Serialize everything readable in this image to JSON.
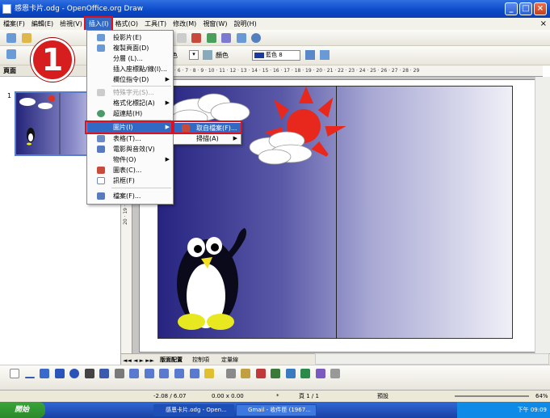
{
  "window": {
    "title": "感恩卡片.odg - OpenOffice.org Draw",
    "min": "_",
    "max": "□",
    "close": "×"
  },
  "menubar": [
    "檔案(F)",
    "編輯(E)",
    "檢視(V)",
    "插入(I)",
    "格式(O)",
    "工具(T)",
    "修改(M)",
    "視窗(W)",
    "說明(H)"
  ],
  "sidebar": {
    "header": "頁面",
    "thumb_number": "1"
  },
  "ruler": {
    "horizontal": "1 · 2 · 3 · 4 · 5 · 6 · 7 · 8 · 9 · 10 · 11 · 12 · 13 · 14 · 15 · 16 · 17 · 18 · 19 · 20 · 21 · 22 · 23 · 24 · 25 · 26 · 27 · 28 · 29",
    "vertical": "20 · 19 · 18 · 17 · 16 · 15 · 14 · 13 · 12 · 11 · 10 · 9"
  },
  "toolbar2": {
    "color_label": "色",
    "fill_label": "顏色",
    "fill_color_label": "藍色 8"
  },
  "insert_menu": {
    "items": [
      {
        "label": "投影片(E)",
        "disabled": false,
        "submenu": false
      },
      {
        "label": "複製頁面(D)",
        "disabled": false,
        "submenu": false
      },
      {
        "label": "分層 (L)...",
        "disabled": false,
        "submenu": false
      },
      {
        "label": "插入座標點/線(I)...",
        "disabled": false,
        "submenu": false
      },
      {
        "label": "欄位指令(D)",
        "disabled": false,
        "submenu": true
      },
      {
        "label": "特殊字元(S)...",
        "disabled": true,
        "submenu": false
      },
      {
        "label": "格式化標記(A)",
        "disabled": false,
        "submenu": true
      },
      {
        "label": "超連結(H)",
        "disabled": false,
        "submenu": false
      },
      {
        "label": "圖片(I)",
        "disabled": false,
        "submenu": true,
        "selected": true
      },
      {
        "label": "表格(T)...",
        "disabled": false,
        "submenu": false
      },
      {
        "label": "電影與音效(V)",
        "disabled": false,
        "submenu": false
      },
      {
        "label": "物件(O)",
        "disabled": false,
        "submenu": true
      },
      {
        "label": "圖表(C)...",
        "disabled": false,
        "submenu": false
      },
      {
        "label": "訊框(F)",
        "disabled": false,
        "submenu": false
      },
      {
        "label": "檔案(F)...",
        "disabled": false,
        "submenu": false
      }
    ]
  },
  "picture_submenu": {
    "items": [
      "取自檔案(F)...",
      "掃描(A)"
    ]
  },
  "step_marker": "1",
  "tabs": [
    "版面配置",
    "控制項",
    "定量線"
  ],
  "statusbar": {
    "position": "-2.08 / 6.07",
    "size": "0.00 x 0.00",
    "modified": "*",
    "page": "頁 1 / 1",
    "layout": "預設",
    "zoom": "64%"
  },
  "taskbar": {
    "start": "開始",
    "tasks": [
      "感恩卡片.odg - Open...",
      "Gmail - 收件匣 (1967..."
    ],
    "clock": "下午 09:09"
  }
}
